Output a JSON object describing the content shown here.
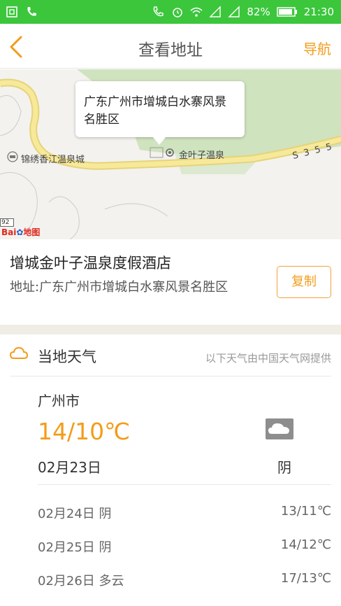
{
  "status_bar": {
    "battery": "82%",
    "time": "21:30"
  },
  "header": {
    "title": "查看地址",
    "nav_label": "导航"
  },
  "map": {
    "bubble_text": "广东广州市增城白水寨风景名胜区",
    "poi_jinyezi": "金叶子温泉",
    "poi_jinxiu": "锦绣香江温泉城",
    "road": "S 3 5 5",
    "scale": "92",
    "logo": "Bai地图"
  },
  "hotel": {
    "name": "增城金叶子温泉度假酒店",
    "address": "地址:广东广州市增城白水寨风景名胜区",
    "copy_label": "复制"
  },
  "weather": {
    "title": "当地天气",
    "source": "以下天气由中国天气网提供",
    "city": "广州市",
    "temp_now": "14/10℃",
    "date_now": "02月23日",
    "cond_now": "阴",
    "forecast": [
      {
        "date": "02月24日 阴",
        "temp": "13/11℃"
      },
      {
        "date": "02月25日 阴",
        "temp": "14/12℃"
      },
      {
        "date": "02月26日 多云",
        "temp": "17/13℃"
      }
    ],
    "accent_color": "#f39c1a"
  },
  "colors": {
    "status_bar": "#3cc63c",
    "accent": "#f39c1a"
  }
}
